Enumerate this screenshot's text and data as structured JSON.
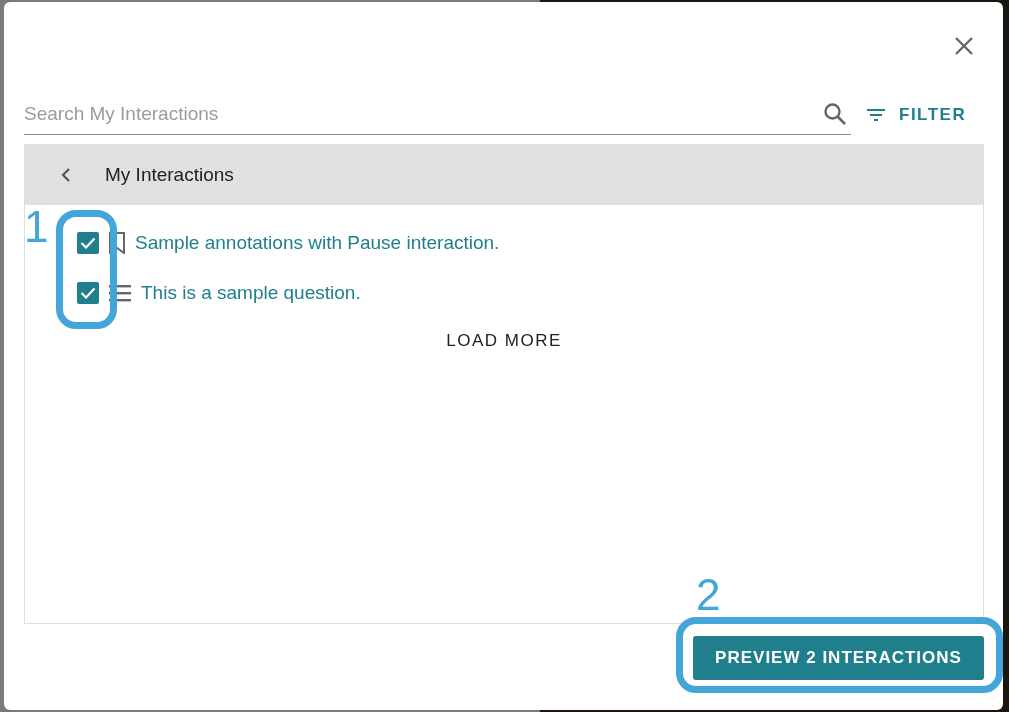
{
  "search": {
    "placeholder": "Search My Interactions"
  },
  "filter": {
    "label": "FILTER"
  },
  "panel": {
    "title": "My Interactions",
    "items": [
      {
        "kind": "annotation",
        "label": "Sample annotations with Pause interaction.",
        "checked": true
      },
      {
        "kind": "question",
        "label": "This is a sample question.",
        "checked": true
      }
    ],
    "load_more": "LOAD MORE"
  },
  "primary_button": {
    "label": "PREVIEW 2 INTERACTIONS"
  },
  "callouts": [
    {
      "number": "1",
      "kind": "checkboxes"
    },
    {
      "number": "2",
      "kind": "button"
    }
  ]
}
